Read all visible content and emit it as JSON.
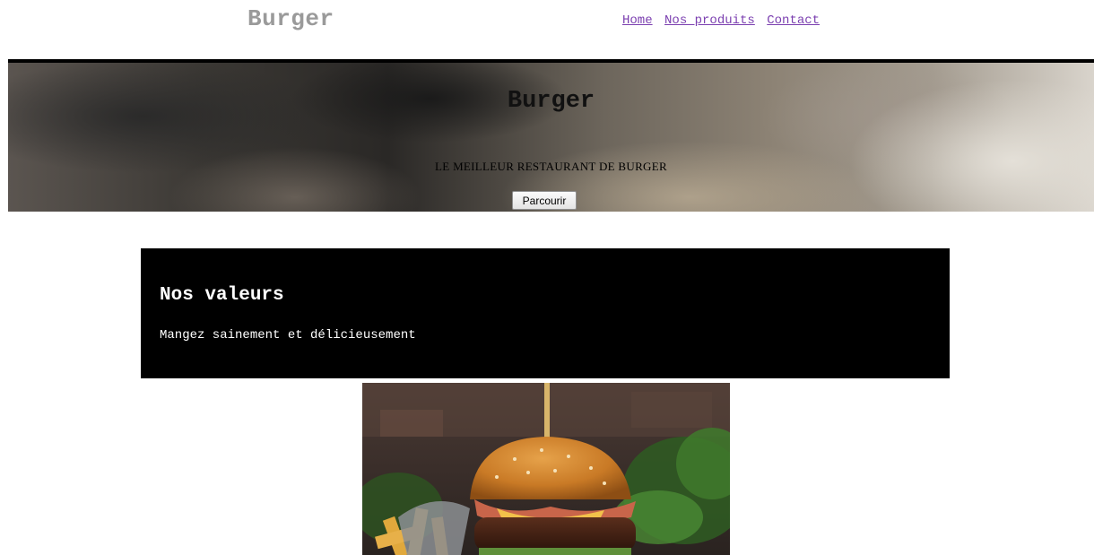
{
  "header": {
    "brand": "Burger",
    "nav": [
      {
        "label": "Home"
      },
      {
        "label": "Nos produits"
      },
      {
        "label": "Contact"
      }
    ]
  },
  "hero": {
    "title": "Burger",
    "subtitle": "LE MEILLEUR RESTAURANT DE BURGER",
    "button_label": "Parcourir"
  },
  "values": {
    "title": "Nos valeurs",
    "text": "Mangez sainement et délicieusement"
  },
  "colors": {
    "brand_gray": "#9a9a9a",
    "link_visited": "#7b3fb0",
    "values_background": "#000000",
    "values_text": "#ffffff"
  },
  "icons": {
    "burger_photo": "burger-photo"
  }
}
